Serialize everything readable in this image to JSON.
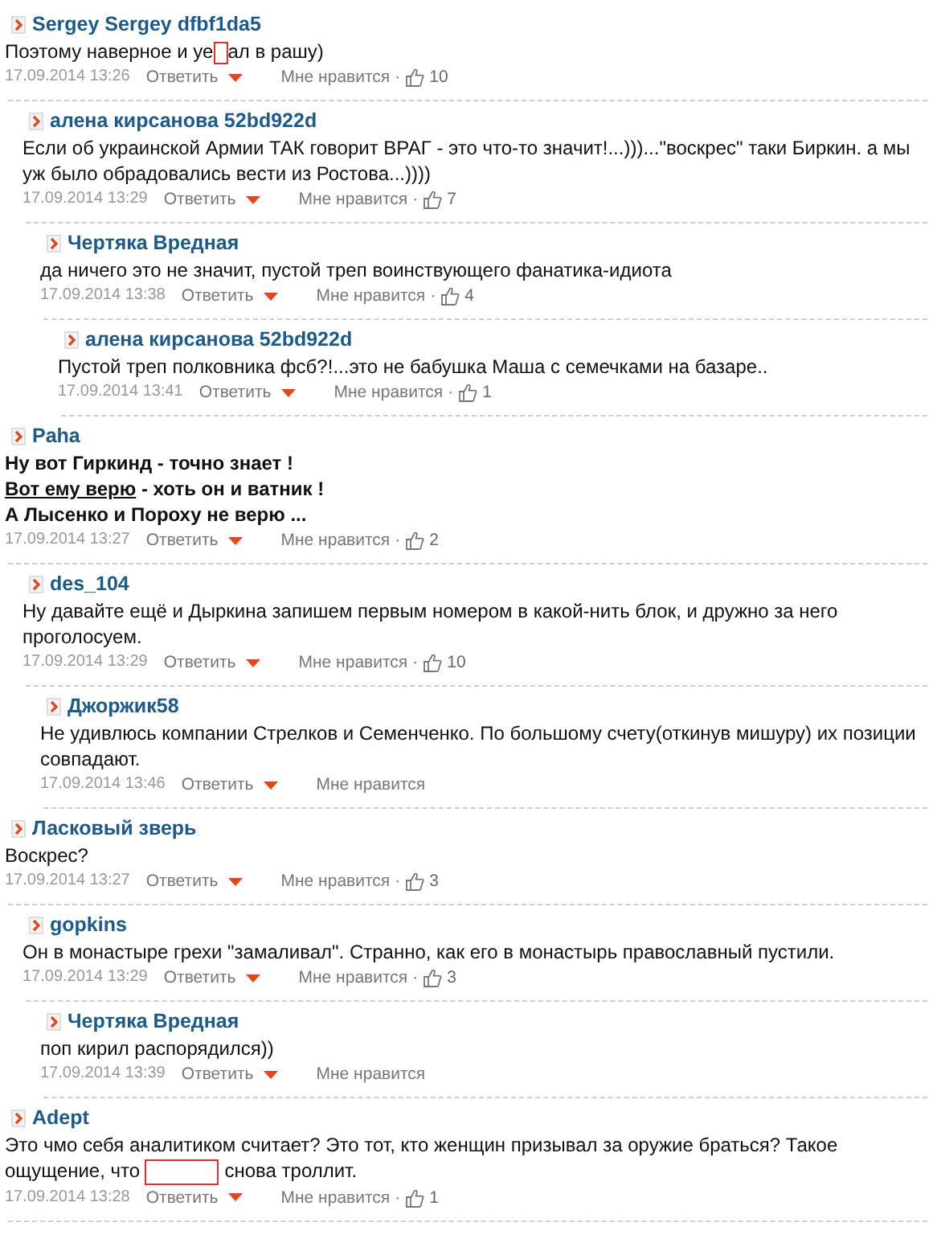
{
  "comments": [
    {
      "author": "Sergey Sergey dfbf1da5",
      "kind": "plain",
      "body": [
        [
          {
            "kind": "text",
            "text": "Поэтому наверное и уе"
          },
          {
            "kind": "censored_char"
          },
          {
            "kind": "text",
            "text": "ал в рашу)"
          }
        ]
      ],
      "date": "17.09.2014 13:26",
      "reply": "Ответить",
      "like": "Мне нравится",
      "dot": "·",
      "likes": "10",
      "children": [
        {
          "author": "алена кирсанова 52bd922d",
          "kind": "plain",
          "body": [
            [
              {
                "kind": "text",
                "text": "Если об украинской Армии ТАК говорит ВРАГ - это что-то значит!...)))...\"воскрес\" таки Биркин. а мы уж было обрадовались вести из Ростова...))))"
              }
            ]
          ],
          "date": "17.09.2014 13:29",
          "reply": "Ответить",
          "like": "Мне нравится",
          "dot": "·",
          "likes": "7",
          "children": [
            {
              "author": "Чертяка Вредная",
              "kind": "plain",
              "body": [
                [
                  {
                    "kind": "text",
                    "text": "да ничего это не значит, пустой треп воинствующего фанатика-идиота"
                  }
                ]
              ],
              "date": "17.09.2014 13:38",
              "reply": "Ответить",
              "like": "Мне нравится",
              "dot": "·",
              "likes": "4",
              "children": [
                {
                  "author": "алена кирсанова 52bd922d",
                  "kind": "plain",
                  "body": [
                    [
                      {
                        "kind": "text",
                        "text": "Пустой треп полковника фсб?!...это не бабушка Маша с семечками на базаре.."
                      }
                    ]
                  ],
                  "date": "17.09.2014 13:41",
                  "reply": "Ответить",
                  "like": "Мне нравится",
                  "dot": "·",
                  "likes": "1"
                }
              ]
            }
          ]
        }
      ]
    },
    {
      "author": "Paha",
      "kind": "bold",
      "body": [
        [
          {
            "kind": "text",
            "text": "Ну вот Гиркинд - точно знает !"
          }
        ],
        [
          {
            "kind": "link",
            "text": "Вот ему верю"
          },
          {
            "kind": "text",
            "text": " - хоть он и ватник !"
          }
        ],
        [
          {
            "kind": "text",
            "text": "А Лысенко и Пороху не верю ..."
          }
        ]
      ],
      "date": "17.09.2014 13:27",
      "reply": "Ответить",
      "like": "Мне нравится",
      "dot": "·",
      "likes": "2",
      "children": [
        {
          "author": "des_104",
          "kind": "plain",
          "body": [
            [
              {
                "kind": "text",
                "text": "Ну давайте ещё и Дыркина запишем первым номером в какой-нить блок, и дружно за него проголосуем."
              }
            ]
          ],
          "date": "17.09.2014 13:29",
          "reply": "Ответить",
          "like": "Мне нравится",
          "dot": "·",
          "likes": "10",
          "children": [
            {
              "author": "Джоржик58",
              "kind": "plain",
              "body": [
                [
                  {
                    "kind": "text",
                    "text": "Не удивлюсь компании Стрелков и Семенченко. По большому счету(откинув мишуру) их позиции совпадают."
                  }
                ]
              ],
              "date": "17.09.2014 13:46",
              "reply": "Ответить",
              "like": "Мне нравится"
            }
          ]
        }
      ]
    },
    {
      "author": "Ласковый зверь",
      "kind": "plain",
      "body": [
        [
          {
            "kind": "text",
            "text": "Воскрес?"
          }
        ]
      ],
      "date": "17.09.2014 13:27",
      "reply": "Ответить",
      "like": "Мне нравится",
      "dot": "·",
      "likes": "3",
      "children": [
        {
          "author": "gopkins",
          "kind": "plain",
          "body": [
            [
              {
                "kind": "text",
                "text": "Он в монастыре грехи \"замаливал\". Странно, как его в монастырь православный пустили."
              }
            ]
          ],
          "date": "17.09.2014 13:29",
          "reply": "Ответить",
          "like": "Мне нравится",
          "dot": "·",
          "likes": "3",
          "children": [
            {
              "author": "Чертяка Вредная",
              "kind": "plain",
              "body": [
                [
                  {
                    "kind": "text",
                    "text": "поп кирил распорядился))"
                  }
                ]
              ],
              "date": "17.09.2014 13:39",
              "reply": "Ответить",
              "like": "Мне нравится"
            }
          ]
        }
      ]
    },
    {
      "author": "Adept",
      "kind": "plain",
      "body": [
        [
          {
            "kind": "text",
            "text": "Это чмо себя аналитиком считает? Это тот, кто женщин призывал за оружие браться? Такое ощущение, что "
          },
          {
            "kind": "censored_word"
          },
          {
            "kind": "text",
            "text": " снова троллит."
          }
        ]
      ],
      "date": "17.09.2014 13:28",
      "reply": "Ответить",
      "like": "Мне нравится",
      "dot": "·",
      "likes": "1"
    }
  ]
}
